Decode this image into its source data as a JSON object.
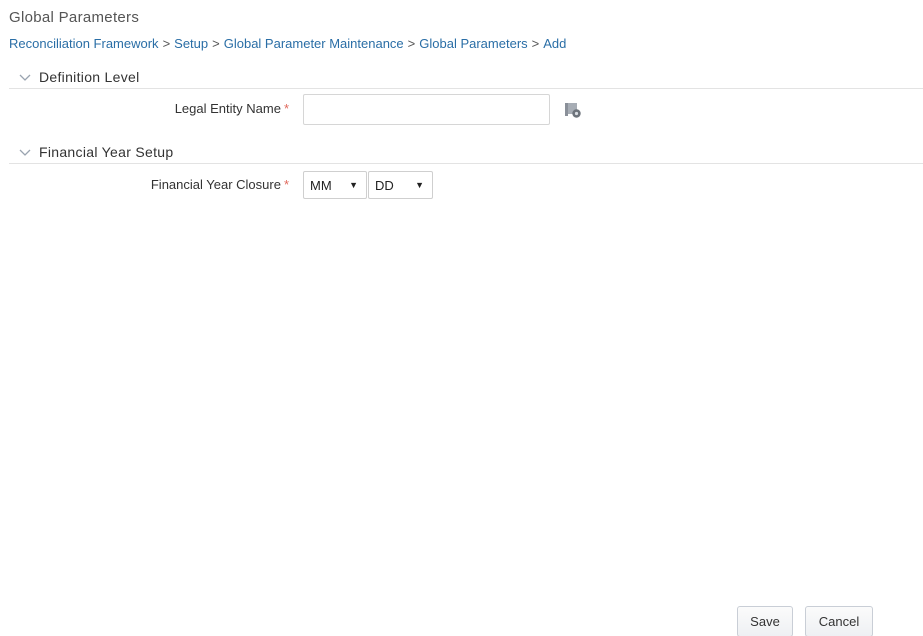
{
  "page": {
    "title": "Global Parameters"
  },
  "breadcrumb": [
    "Reconciliation Framework",
    "Setup",
    "Global Parameter Maintenance",
    "Global Parameters",
    "Add"
  ],
  "breadcrumb_separator": ">",
  "sections": {
    "definition_level": {
      "title": "Definition Level",
      "fields": {
        "legal_entity": {
          "label": "Legal Entity Name",
          "required_marker": "*",
          "value": "",
          "lookup_icon": "browse-hierarchy-icon"
        }
      }
    },
    "financial_year_setup": {
      "title": "Financial Year Setup",
      "fields": {
        "financial_year_closure": {
          "label": "Financial Year Closure",
          "required_marker": "*",
          "month_value": "MM",
          "day_value": "DD"
        }
      }
    }
  },
  "footer": {
    "save_label": "Save",
    "cancel_label": "Cancel"
  },
  "colors": {
    "link": "#2a6ea6",
    "required": "#e0685b",
    "text": "#333333",
    "divider": "#e3e3e3"
  }
}
